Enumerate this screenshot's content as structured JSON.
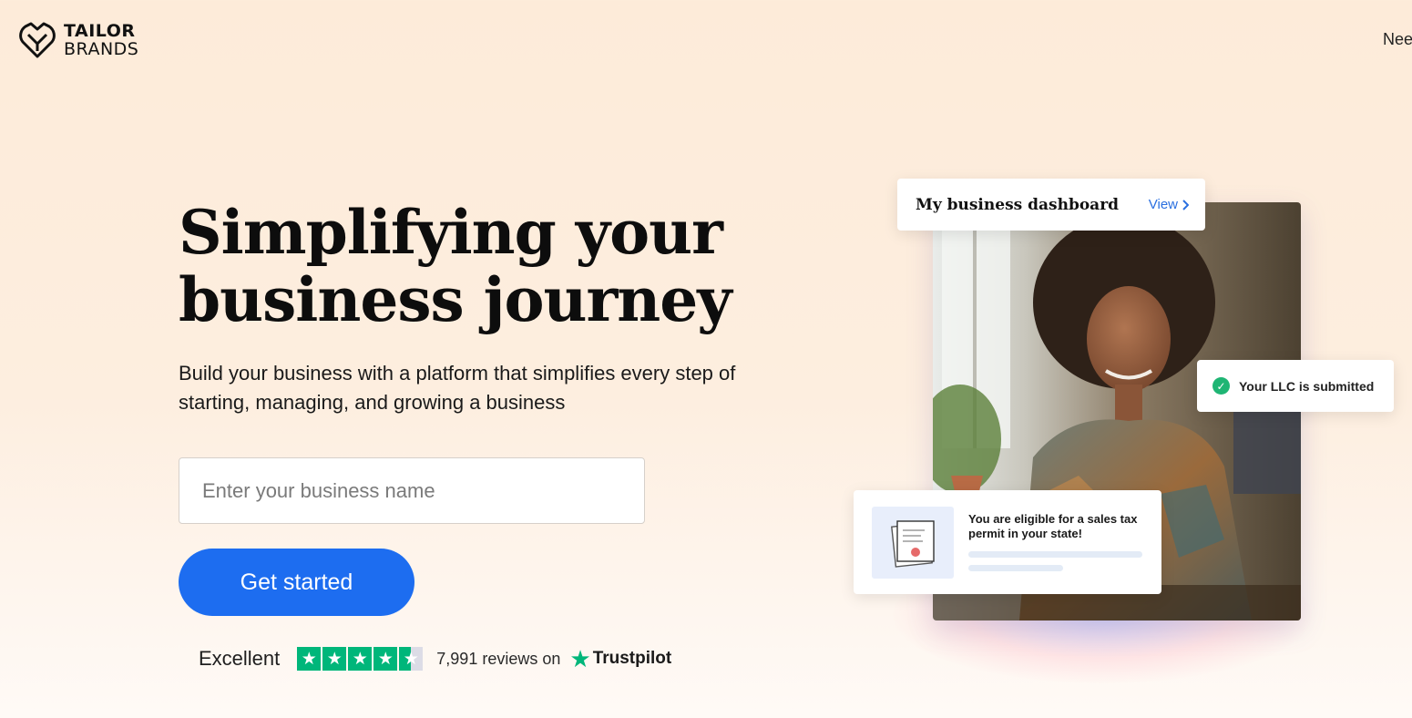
{
  "header": {
    "logo_line1": "TAILOR",
    "logo_line2": "BRANDS",
    "logo_icon": "heart-shield-icon",
    "need_help": "Nee"
  },
  "hero": {
    "title": "Simplifying your business journey",
    "subtitle": "Build your business with a platform that simplifies every step of starting, managing, and growing a business",
    "input_placeholder": "Enter your business name",
    "input_value": "",
    "cta_label": "Get started"
  },
  "rating": {
    "label": "Excellent",
    "stars": 4.5,
    "reviews_text": "7,991 reviews on",
    "provider": "Trustpilot",
    "star_color": "#00b67a"
  },
  "illustration": {
    "dashboard_title": "My business dashboard",
    "dashboard_link": "View",
    "llc_status": "Your LLC is submitted",
    "tax_message": "You are eligible for a sales tax permit in your state!"
  },
  "colors": {
    "accent": "#1d6df0",
    "background": "#fdebd9",
    "success": "#1fb574"
  }
}
